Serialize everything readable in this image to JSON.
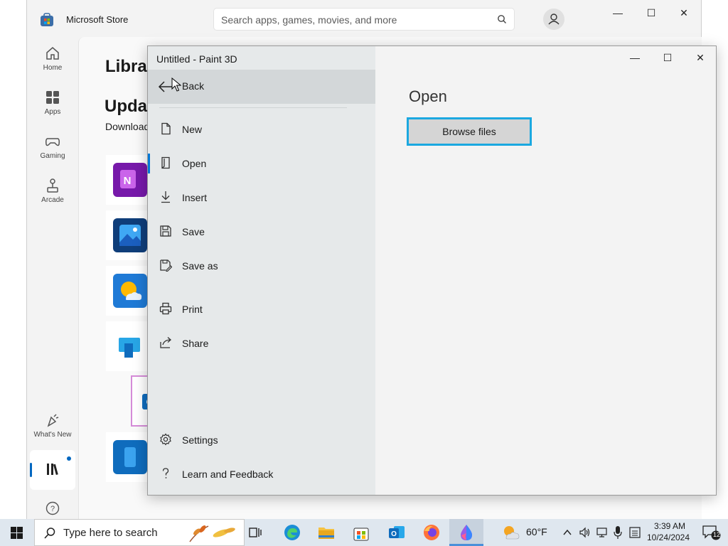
{
  "store": {
    "title": "Microsoft Store",
    "search_placeholder": "Search apps, games, movies, and more",
    "window_controls": {
      "minimize": "—",
      "maximize": "☐",
      "close": "✕"
    },
    "rail": [
      {
        "label": "Home"
      },
      {
        "label": "Apps"
      },
      {
        "label": "Gaming"
      },
      {
        "label": "Arcade"
      },
      {
        "label": "What's New"
      }
    ],
    "library_heading": "Librar",
    "updates_heading": "Updat",
    "updates_sub": "Download",
    "app_tiles": [
      {
        "name": "OneNote",
        "color": "#7719aa"
      },
      {
        "name": "Photos",
        "color": "#0f5fb3"
      },
      {
        "name": "Weather",
        "color": "#1f7ad6"
      },
      {
        "name": "Remote Desktop",
        "color": "#ffffff"
      },
      {
        "name": "Outlook",
        "color": "#ffffff"
      },
      {
        "name": "Phone Link",
        "color": "#0f6cbd"
      }
    ]
  },
  "paint": {
    "title": "Untitled - Paint 3D",
    "window_controls": {
      "minimize": "—",
      "maximize": "☐",
      "close": "✕"
    },
    "back_label": "Back",
    "menu": [
      {
        "label": "New",
        "icon": "new-file-icon"
      },
      {
        "label": "Open",
        "icon": "open-icon"
      },
      {
        "label": "Insert",
        "icon": "insert-icon"
      },
      {
        "label": "Save",
        "icon": "save-icon"
      },
      {
        "label": "Save as",
        "icon": "save-as-icon"
      },
      {
        "label": "Print",
        "icon": "print-icon"
      },
      {
        "label": "Share",
        "icon": "share-icon"
      },
      {
        "label": "Settings",
        "icon": "settings-icon"
      },
      {
        "label": "Learn and Feedback",
        "icon": "help-icon"
      }
    ],
    "open_heading": "Open",
    "browse_label": "Browse files",
    "accent": "#1ba8e0"
  },
  "taskbar": {
    "search_placeholder": "Type here to search",
    "weather_temp": "60°F",
    "time": "3:39 AM",
    "date": "10/24/2024",
    "notification_count": "12"
  }
}
